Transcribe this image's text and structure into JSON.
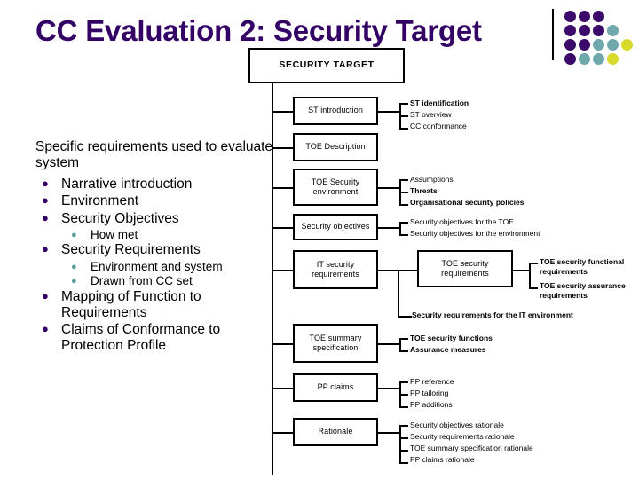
{
  "slide": {
    "title": "CC Evaluation 2: Security Target",
    "title_color": "#330066",
    "lead": "Specific requirements used to evaluate system",
    "bullets": [
      {
        "level": 1,
        "marker": "●",
        "text": "Narrative introduction"
      },
      {
        "level": 1,
        "marker": "●",
        "text": "Environment"
      },
      {
        "level": 1,
        "marker": "●",
        "text": "Security Objectives"
      },
      {
        "level": 2,
        "marker": "●",
        "text": "How met"
      },
      {
        "level": 1,
        "marker": "●",
        "text": "Security Requirements"
      },
      {
        "level": 2,
        "marker": "●",
        "text": "Environment and system"
      },
      {
        "level": 2,
        "marker": "●",
        "text": "Drawn from CC set"
      },
      {
        "level": 1,
        "marker": "●",
        "text": "Mapping of Function to Requirements"
      },
      {
        "level": 1,
        "marker": "●",
        "text": "Claims of Conformance to Protection Profile"
      }
    ]
  },
  "decor": {
    "name": "dot-grid-motif",
    "colors": {
      "purple": "#3b0a6b",
      "teal": "#6fa8ac",
      "yellow": "#d9d92b"
    },
    "dots": [
      {
        "row": 0,
        "col": 0,
        "color": "#3b0a6b"
      },
      {
        "row": 0,
        "col": 1,
        "color": "#3b0a6b"
      },
      {
        "row": 0,
        "col": 2,
        "color": "#3b0a6b"
      },
      {
        "row": 1,
        "col": 0,
        "color": "#3b0a6b"
      },
      {
        "row": 1,
        "col": 1,
        "color": "#3b0a6b"
      },
      {
        "row": 1,
        "col": 2,
        "color": "#3b0a6b"
      },
      {
        "row": 1,
        "col": 3,
        "color": "#6fa8ac"
      },
      {
        "row": 2,
        "col": 0,
        "color": "#3b0a6b"
      },
      {
        "row": 2,
        "col": 1,
        "color": "#3b0a6b"
      },
      {
        "row": 2,
        "col": 2,
        "color": "#6fa8ac"
      },
      {
        "row": 2,
        "col": 3,
        "color": "#6fa8ac"
      },
      {
        "row": 2,
        "col": 4,
        "color": "#d9d92b"
      },
      {
        "row": 3,
        "col": 0,
        "color": "#3b0a6b"
      },
      {
        "row": 3,
        "col": 1,
        "color": "#6fa8ac"
      },
      {
        "row": 3,
        "col": 2,
        "color": "#6fa8ac"
      },
      {
        "row": 3,
        "col": 3,
        "color": "#d9d92b"
      }
    ]
  },
  "diagram": {
    "root": "SECURITY TARGET",
    "nodes": [
      {
        "id": "st-introduction",
        "label": "ST introduction"
      },
      {
        "id": "toe-description",
        "label": "TOE Description"
      },
      {
        "id": "toe-security-environment",
        "label": "TOE Security environment"
      },
      {
        "id": "security-objectives",
        "label": "Security objectives"
      },
      {
        "id": "it-security-requirements",
        "label": "IT security requirements"
      },
      {
        "id": "toe-security-requirements",
        "label": "TOE security requirements"
      },
      {
        "id": "toe-summary-specification",
        "label": "TOE summary specification"
      },
      {
        "id": "pp-claims",
        "label": "PP claims"
      },
      {
        "id": "rationale",
        "label": "Rationale"
      }
    ],
    "leaves": {
      "st_introduction": [
        "ST identification",
        "ST overview",
        "CC conformance"
      ],
      "toe_security_environment": [
        "Assumptions",
        "Threats",
        "Organisational security policies"
      ],
      "security_objectives": [
        "Security objectives for the TOE",
        "Security objectives for the environment"
      ],
      "toe_security_requirements": [
        "TOE security functional requirements",
        "TOE security assurance requirements"
      ],
      "it_security_requirements_extra": [
        "Security requirements for the IT environment"
      ],
      "toe_summary_specification": [
        "TOE security functions",
        "Assurance measures"
      ],
      "pp_claims": [
        "PP reference",
        "PP tailoring",
        "PP additions"
      ],
      "rationale": [
        "Security objectives rationale",
        "Security requirements rationale",
        "TOE summary specification rationale",
        "PP claims rationale"
      ]
    }
  }
}
